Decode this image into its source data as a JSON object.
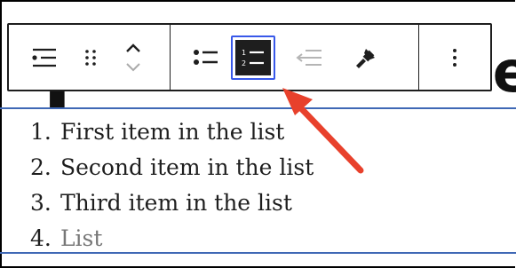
{
  "heading": {
    "fragment_left": "P",
    "fragment_right": "te"
  },
  "toolbar": {
    "groups": {
      "block_controls": [
        "list-block-icon",
        "drag-handle-icon",
        "move-up-down-icon"
      ],
      "list_controls": [
        "unordered-list-icon",
        "ordered-list-icon",
        "outdent-icon",
        "indent-icon"
      ],
      "more": [
        "more-options-icon"
      ]
    },
    "active_item": "ordered-list",
    "accent_color": "#3858e9"
  },
  "annotation": {
    "arrow_color": "#e8412c",
    "points_to": "ordered-list-button"
  },
  "list": {
    "items": [
      {
        "number": "1.",
        "text": "First item in the list"
      },
      {
        "number": "2.",
        "text": "Second item in the list"
      },
      {
        "number": "3.",
        "text": "Third item in the list"
      },
      {
        "number": "4.",
        "text": "List"
      }
    ],
    "border_color": "#3f68b5"
  }
}
